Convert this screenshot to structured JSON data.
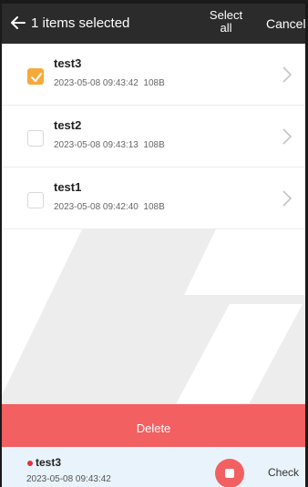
{
  "header": {
    "title": "1 items selected",
    "select_all": "Select all",
    "cancel": "Cancel"
  },
  "items": [
    {
      "name": "test3",
      "date": "2023-05-08 09:43:42",
      "size": "108B",
      "selected": true
    },
    {
      "name": "test2",
      "date": "2023-05-08 09:43:13",
      "size": "108B",
      "selected": false
    },
    {
      "name": "test1",
      "date": "2023-05-08 09:42:40",
      "size": "108B",
      "selected": false
    }
  ],
  "delete_label": "Delete",
  "player": {
    "name": "test3",
    "time": "2023-05-08 09:43:42",
    "check_label": "Check"
  },
  "colors": {
    "header_bg": "#2b2b2b",
    "accent_orange": "#f6a93b",
    "delete_red": "#f26062",
    "player_bg": "#e9f3fb"
  }
}
